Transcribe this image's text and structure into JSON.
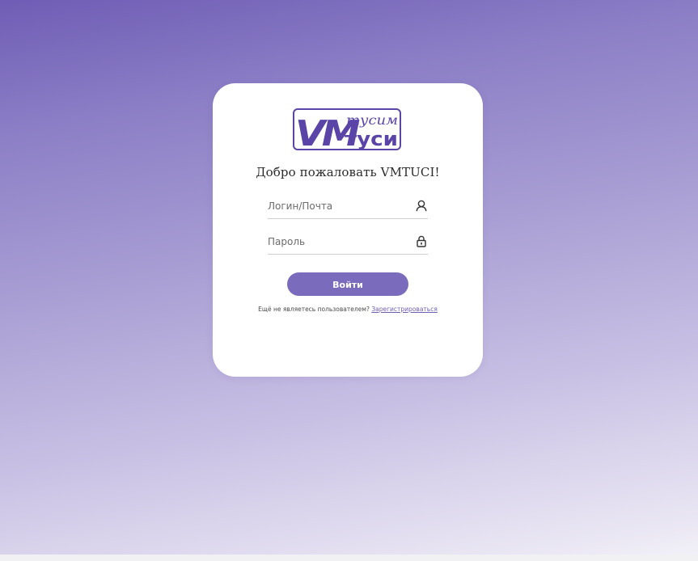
{
  "logo": {
    "main": "VM",
    "top_right": "тусим",
    "bottom_right": "туси"
  },
  "welcome_text": "Добро пожаловать VMTUCI!",
  "login": {
    "placeholder": "Логин/Почта",
    "value": "",
    "icon": "user-icon"
  },
  "password": {
    "placeholder": "Пароль",
    "value": "",
    "icon": "lock-icon"
  },
  "submit_label": "Войти",
  "register": {
    "prompt": "Ещё не являетесь пользователем?",
    "link_label": "Зарегистрироваться"
  },
  "colors": {
    "accent": "#7b6bbd",
    "logo": "#5a44a8",
    "background_top": "#6f5db5",
    "background_bottom": "#f3f2f7",
    "card": "#ffffff"
  }
}
